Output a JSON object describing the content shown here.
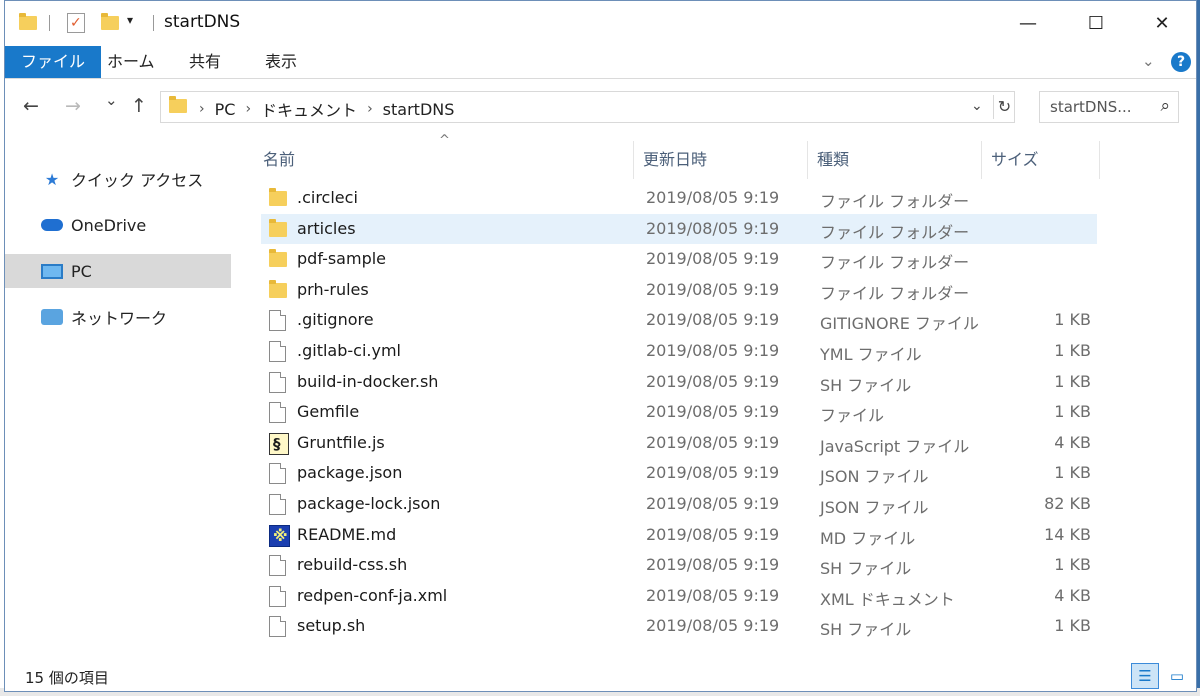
{
  "window": {
    "title": "startDNS",
    "qa_dropdown": "▾",
    "controls": {
      "minimize": "—",
      "maximize": "☐",
      "close": "✕"
    }
  },
  "ribbon": {
    "tabs": [
      {
        "label": "ファイル"
      },
      {
        "label": "ホーム"
      },
      {
        "label": "共有"
      },
      {
        "label": "表示"
      }
    ],
    "expand": "⌄",
    "help": "?"
  },
  "nav": {
    "back": "←",
    "forward": "→",
    "recent": "⌄",
    "up": "↑",
    "breadcrumbs": [
      "PC",
      "ドキュメント",
      "startDNS"
    ],
    "separator": "›",
    "refresh": "↻",
    "search_placeholder": "startDNS..."
  },
  "sidebar": {
    "items": [
      {
        "label": "クイック アクセス",
        "icon": "star-icon"
      },
      {
        "label": "OneDrive",
        "icon": "cloud-icon"
      },
      {
        "label": "PC",
        "icon": "computer-icon",
        "selected": true
      },
      {
        "label": "ネットワーク",
        "icon": "network-icon"
      }
    ]
  },
  "columns": [
    "名前",
    "更新日時",
    "種類",
    "サイズ"
  ],
  "sort_indicator": "^",
  "files": [
    {
      "name": ".circleci",
      "date": "2019/08/05 9:19",
      "type": "ファイル フォルダー",
      "size": "",
      "icon": "folder"
    },
    {
      "name": "articles",
      "date": "2019/08/05 9:19",
      "type": "ファイル フォルダー",
      "size": "",
      "icon": "folder",
      "selected": true
    },
    {
      "name": "pdf-sample",
      "date": "2019/08/05 9:19",
      "type": "ファイル フォルダー",
      "size": "",
      "icon": "folder"
    },
    {
      "name": "prh-rules",
      "date": "2019/08/05 9:19",
      "type": "ファイル フォルダー",
      "size": "",
      "icon": "folder"
    },
    {
      "name": ".gitignore",
      "date": "2019/08/05 9:19",
      "type": "GITIGNORE ファイル",
      "size": "1 KB",
      "icon": "doc"
    },
    {
      "name": ".gitlab-ci.yml",
      "date": "2019/08/05 9:19",
      "type": "YML ファイル",
      "size": "1 KB",
      "icon": "doc"
    },
    {
      "name": "build-in-docker.sh",
      "date": "2019/08/05 9:19",
      "type": "SH ファイル",
      "size": "1 KB",
      "icon": "doc"
    },
    {
      "name": "Gemfile",
      "date": "2019/08/05 9:19",
      "type": "ファイル",
      "size": "1 KB",
      "icon": "doc"
    },
    {
      "name": "Gruntfile.js",
      "date": "2019/08/05 9:19",
      "type": "JavaScript ファイル",
      "size": "4 KB",
      "icon": "js"
    },
    {
      "name": "package.json",
      "date": "2019/08/05 9:19",
      "type": "JSON ファイル",
      "size": "1 KB",
      "icon": "doc"
    },
    {
      "name": "package-lock.json",
      "date": "2019/08/05 9:19",
      "type": "JSON ファイル",
      "size": "82 KB",
      "icon": "doc"
    },
    {
      "name": "README.md",
      "date": "2019/08/05 9:19",
      "type": "MD ファイル",
      "size": "14 KB",
      "icon": "md"
    },
    {
      "name": "rebuild-css.sh",
      "date": "2019/08/05 9:19",
      "type": "SH ファイル",
      "size": "1 KB",
      "icon": "doc"
    },
    {
      "name": "redpen-conf-ja.xml",
      "date": "2019/08/05 9:19",
      "type": "XML ドキュメント",
      "size": "4 KB",
      "icon": "doc"
    },
    {
      "name": "setup.sh",
      "date": "2019/08/05 9:19",
      "type": "SH ファイル",
      "size": "1 KB",
      "icon": "doc"
    }
  ],
  "status": {
    "count": "15 個の項目"
  },
  "colors": {
    "accent": "#1979ca",
    "selection": "#e5f1fb",
    "nav_selected": "#d9d9d9"
  }
}
